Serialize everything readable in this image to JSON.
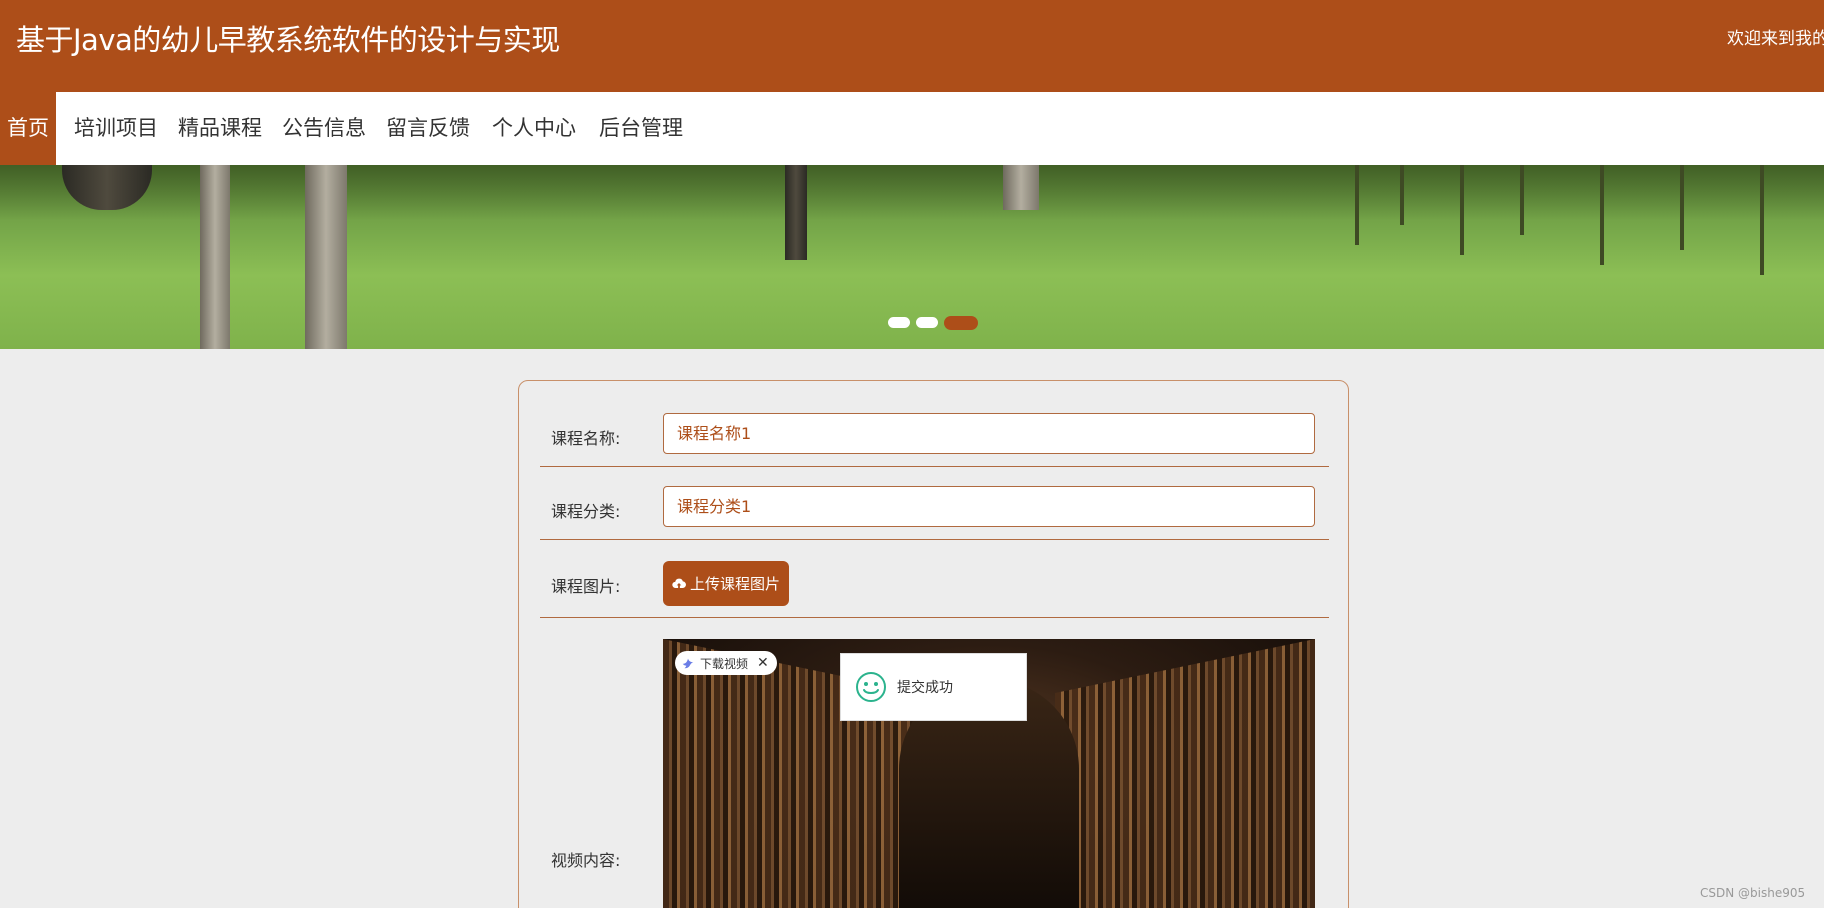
{
  "header": {
    "title": "基于Java的幼儿早教系统软件的设计与实现",
    "welcome": "欢迎来到我的"
  },
  "nav": {
    "items": [
      {
        "label": "首页",
        "active": true
      },
      {
        "label": "培训项目"
      },
      {
        "label": "精品课程"
      },
      {
        "label": "公告信息"
      },
      {
        "label": "留言反馈"
      },
      {
        "label": "个人中心"
      },
      {
        "label": "后台管理"
      }
    ]
  },
  "banner": {
    "slide_count": 3,
    "active_slide": 3
  },
  "form": {
    "course_name_label": "课程名称:",
    "course_name_value": "课程名称1",
    "course_category_label": "课程分类:",
    "course_category_value": "课程分类1",
    "course_image_label": "课程图片:",
    "upload_button": "上传课程图片",
    "video_label": "视频内容:",
    "download_chip": "下载视频"
  },
  "toast": {
    "message": "提交成功"
  },
  "watermark": "CSDN @bishe905",
  "colors": {
    "primary": "#ad4e19",
    "background": "#ededed",
    "success": "#2bb38d"
  }
}
